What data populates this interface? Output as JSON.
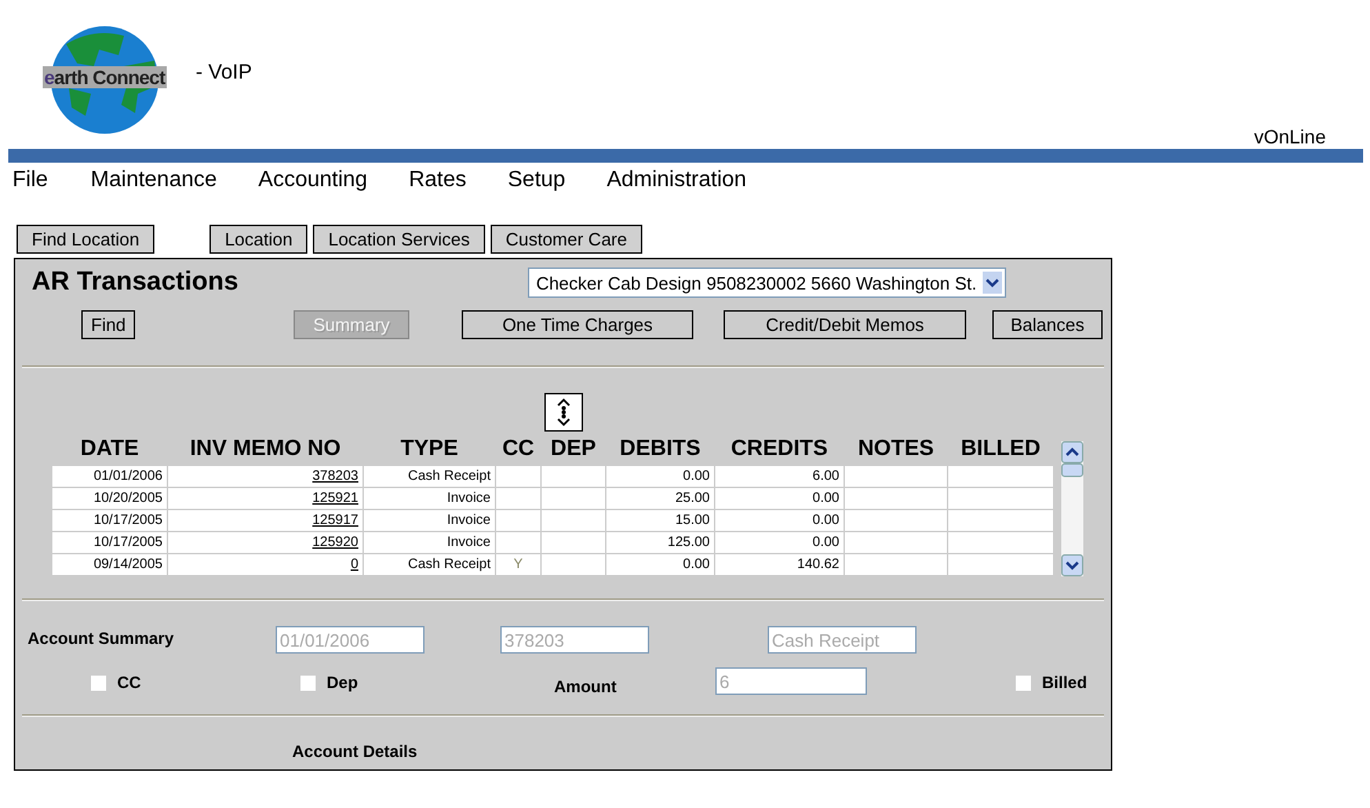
{
  "header": {
    "logo_text": "earth Connect",
    "suffix": "- VoIP",
    "app_name": "vOnLine"
  },
  "menu": [
    "File",
    "Maintenance",
    "Accounting",
    "Rates",
    "Setup",
    "Administration"
  ],
  "nav_buttons": [
    "Find Location",
    "Location",
    "Location Services",
    "Customer Care"
  ],
  "panel": {
    "title": "AR Transactions",
    "account_select": "Checker Cab Design 9508230002 5660 Washington St.",
    "buttons": [
      {
        "label": "Find",
        "disabled": false
      },
      {
        "label": "Summary",
        "disabled": true
      },
      {
        "label": "One Time Charges",
        "disabled": false
      },
      {
        "label": "Credit/Debit Memos",
        "disabled": false
      },
      {
        "label": "Balances",
        "disabled": false
      }
    ],
    "table": {
      "columns": [
        "DATE",
        "INV MEMO NO",
        "TYPE",
        "CC",
        "DEP",
        "DEBITS",
        "CREDITS",
        "NOTES",
        "BILLED"
      ],
      "rows": [
        {
          "date": "01/01/2006",
          "inv_memo_no": "378203",
          "type": "Cash Receipt",
          "cc": "",
          "dep": "",
          "debits": "0.00",
          "credits": "6.00"
        },
        {
          "date": "10/20/2005",
          "inv_memo_no": "125921",
          "type": "Invoice",
          "cc": "",
          "dep": "",
          "debits": "25.00",
          "credits": "0.00"
        },
        {
          "date": "10/17/2005",
          "inv_memo_no": "125917",
          "type": "Invoice",
          "cc": "",
          "dep": "",
          "debits": "15.00",
          "credits": "0.00"
        },
        {
          "date": "10/17/2005",
          "inv_memo_no": "125920",
          "type": "Invoice",
          "cc": "",
          "dep": "",
          "debits": "125.00",
          "credits": "0.00"
        },
        {
          "date": "09/14/2005",
          "inv_memo_no": "0",
          "type": "Cash Receipt",
          "cc": "Y",
          "dep": "",
          "debits": "0.00",
          "credits": "140.62"
        }
      ]
    },
    "summary": {
      "label": "Account Summary",
      "fields": [
        "01/01/2006",
        "378203",
        "Cash Receipt"
      ],
      "cc": {
        "label": "CC",
        "checked": false
      },
      "dep": {
        "label": "Dep",
        "checked": false
      },
      "amount_label": "Amount",
      "amount": "6",
      "billed": {
        "label": "Billed",
        "checked": false
      },
      "details_label": "Account Details"
    }
  }
}
